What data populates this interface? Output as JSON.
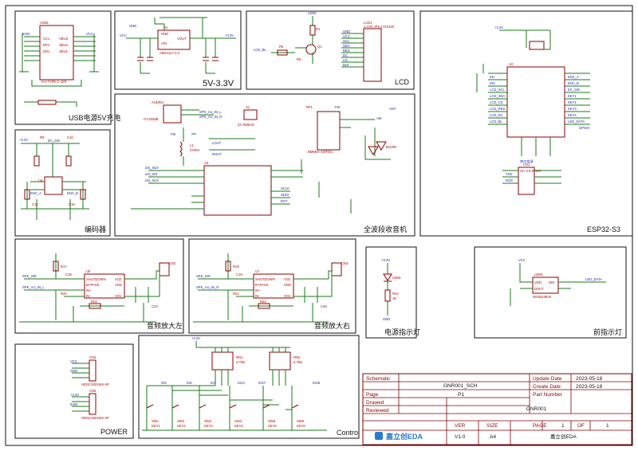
{
  "panels": {
    "usb_title": "USB电源5V充电",
    "regulator_title": "5V-3.3V",
    "lcd_title": "LCD",
    "encoder_title": "编码器",
    "radio_title": "全波段收音机",
    "esp_title": "ESP32-S3",
    "amp_left_title": "音频放大左",
    "amp_right_title": "音频放大右",
    "power_led_title": "电源指示灯",
    "front_led_title": "前指示灯",
    "power_title": "POWER",
    "control_title": "Control"
  },
  "labels": {
    "usb": {
      "ref": "USB1",
      "sub": "KH-TYPE-C-16P",
      "nets": [
        "5VIN",
        "5VIN",
        "5VIN",
        "5VIN",
        "VCC",
        "CC1",
        "DP1",
        "DN1",
        "CC2",
        "DP2",
        "DN2",
        "VBUS",
        "SBU2",
        "SBU1",
        "R1",
        "R2"
      ],
      "r_desc": "5.1K"
    },
    "regulator": {
      "ref": "U1",
      "part": "AMS1117-3.3",
      "vcc": "VCC",
      "out": "+3.3V",
      "gnd": "GND",
      "pins": [
        "GND",
        "VOUT",
        "VIN",
        "VOUT"
      ],
      "caps": [
        "C4",
        "C5",
        "C2",
        "C3"
      ]
    },
    "lcd": {
      "ref": "LCD1",
      "part": "1.47IC IPS 172X320",
      "ledk": "LEDK",
      "q": "Q1",
      "r1": "R1",
      "r5": "R5",
      "r8": "R8",
      "bl": "LCD_BL",
      "pins": [
        "GND",
        "VCC",
        "SCL",
        "SDA",
        "RES",
        "DC",
        "CS",
        "BLK"
      ]
    },
    "encoder": {
      "ref": "U4",
      "nets": [
        "+3.3V",
        "EC_SW",
        "ENC_A",
        "ENC_B"
      ],
      "parts": [
        "R9",
        "R10",
        "R11",
        "R12",
        "R13",
        "R14",
        "C10",
        "C15",
        "C16"
      ]
    },
    "radio": {
      "ref": "U3",
      "ant": "ANT",
      "fm": "FM",
      "audio": "AUDIO1",
      "jack": "PJ-3326B",
      "xtal": "X1",
      "xtal_f": "32.768KHz",
      "chip": "BM8MA-4SP001",
      "diode": "BAV99",
      "nets": [
        "SPK_AU_IN_L",
        "SPK_AU_IN_R",
        "LOUT",
        "ROUT",
        "I2S_SDA",
        "I2S_WS",
        "I2S_SCK",
        "FM",
        "AM",
        "RCLK",
        "SCLK",
        "SDIO",
        "RST"
      ],
      "l1": "L1",
      "l1v": "270nH",
      "rf": "RF1"
    },
    "esp": {
      "ref": "U2",
      "part": "ESP32-S3",
      "cn": "CN1",
      "cn_part": "HC-3.0-6PWT",
      "uart": "串口烧录",
      "nets": [
        "EN",
        "IO0",
        "TXD",
        "RXD",
        "LCD_SCL",
        "LCD_SDA",
        "LCD_CS",
        "LCD_RES",
        "LCD_DC",
        "LCD_BL",
        "ENC_A",
        "ENC_B",
        "EC_SW",
        "KEY1",
        "KEY2",
        "KEY3",
        "KEY4",
        "KEY5",
        "KEY6",
        "LED_DATA",
        "GPIO0"
      ]
    },
    "amp": {
      "refs": [
        "U5",
        "U7"
      ],
      "pins": [
        "SHUTDOWN",
        "BYPASS",
        "IN+",
        "IN-",
        "VO2",
        "VDD",
        "GND",
        "VO1"
      ],
      "nets": [
        "SPK_SW",
        "SPK_AU_IN_L",
        "SPK_AU_IN_R"
      ],
      "cn": [
        "CN2",
        "CN3"
      ],
      "parts": [
        "R17",
        "R20",
        "R22",
        "C18",
        "C20",
        "C21",
        "C22",
        "C24",
        "R19",
        "R21",
        "R23",
        "C19",
        "C23",
        "C25"
      ]
    },
    "power_led": {
      "ref": "LED5",
      "r": "R24",
      "rv": "1K",
      "vcc": "+3.3V",
      "gnd": "GND"
    },
    "front_led": {
      "ref": "LED6",
      "part": "WS2812B-B",
      "net": "LED_DATA",
      "vcc": "VCC",
      "pins": [
        "VDD",
        "DIN",
        "DOUT",
        "GND"
      ]
    },
    "power": {
      "connectors": [
        "CN4",
        "CN5"
      ],
      "parts": [
        "HDGC2001WV-4P",
        "HDGC2001WV-4P"
      ],
      "nets": [
        "VCC",
        "GND",
        "+3.3V",
        "5VIN"
      ]
    },
    "control": {
      "rn": [
        "RN1",
        "RN2"
      ],
      "rnv": "4.7kΩ",
      "vcc": "+3.3V",
      "io": [
        "IO5",
        "IO6",
        "IO4",
        "IO21",
        "IO47",
        "IO48"
      ],
      "keys": [
        "SW1",
        "SW2",
        "SW3",
        "SW4",
        "SW5",
        "SW6"
      ],
      "key_labels": [
        "KEY1",
        "KEY2",
        "KEY3",
        "KEY4",
        "KEY5",
        "KEY6"
      ]
    }
  },
  "title_block": {
    "schematic_label": "Schematic",
    "schematic_value": "GNR001_SCH",
    "page_label": "Page",
    "page_value": "P1",
    "drawed_label": "Drawed",
    "reviewed_label": "Reviewed",
    "update_label": "Update Date",
    "update_value": "2023-05-18",
    "create_label": "Create Date",
    "create_value": "2023-05-18",
    "part_label": "Part Number",
    "project": "GNR001",
    "ver_label": "VER",
    "ver_value": "V1.0",
    "size_label": "SIZE",
    "size_value": "A4",
    "page_num_label": "PAGE",
    "page_num": "1",
    "of_label": "OF",
    "of_num": "1",
    "company": "嘉立创EDA",
    "logo_text": "嘉立创EDA"
  },
  "colors": {
    "wire": "#1a7a1a",
    "body": "#8a0000",
    "net": "#1a1aa0",
    "frame": "#111111",
    "logo": "#2a7ad0"
  }
}
